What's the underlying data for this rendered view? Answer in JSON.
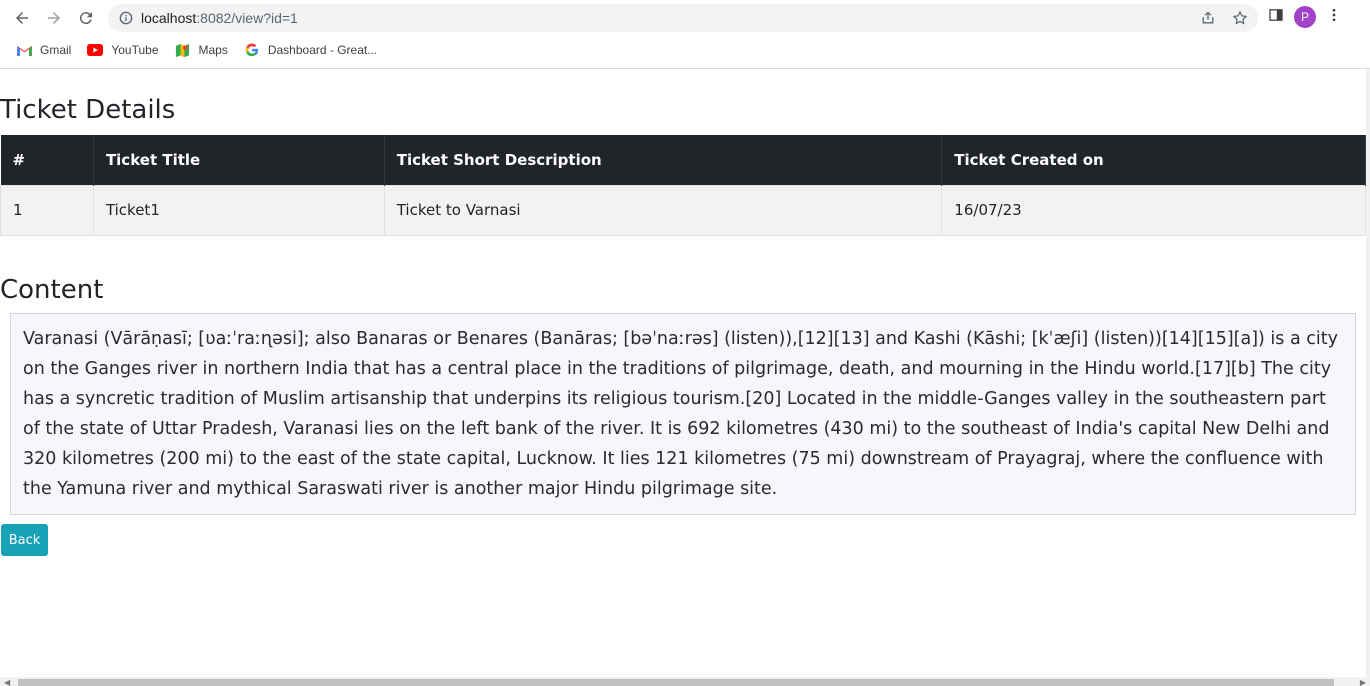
{
  "browser": {
    "url_host": "localhost",
    "url_rest": ":8082/view?id=1",
    "profile_initial": "P",
    "bookmarks": [
      {
        "label": "Gmail",
        "icon": "gmail-icon"
      },
      {
        "label": "YouTube",
        "icon": "youtube-icon"
      },
      {
        "label": "Maps",
        "icon": "maps-icon"
      },
      {
        "label": "Dashboard - Great...",
        "icon": "google-icon"
      }
    ]
  },
  "page": {
    "details_title": "Ticket Details",
    "table": {
      "headers": [
        "#",
        "Ticket Title",
        "Ticket Short Description",
        "Ticket Created on"
      ],
      "rows": [
        [
          "1",
          "Ticket1",
          "Ticket to Varnasi",
          "16/07/23"
        ]
      ]
    },
    "content_title": "Content",
    "content_text": "Varanasi (Vārāṇasī; [ʋaːˈraːɳəsi]; also Banaras or Benares (Banāras; [bəˈnaːrəs] (listen)),[12][13] and Kashi (Kāshi; [kˈæʃi] (listen))[14][15][a]) is a city on the Ganges river in northern India that has a central place in the traditions of pilgrimage, death, and mourning in the Hindu world.[17][b] The city has a syncretic tradition of Muslim artisanship that underpins its religious tourism.[20] Located in the middle-Ganges valley in the southeastern part of the state of Uttar Pradesh, Varanasi lies on the left bank of the river. It is 692 kilometres (430 mi) to the southeast of India's capital New Delhi and 320 kilometres (200 mi) to the east of the state capital, Lucknow. It lies 121 kilometres (75 mi) downstream of Prayagraj, where the confluence with the Yamuna river and mythical Saraswati river is another major Hindu pilgrimage site.",
    "back_label": "Back"
  },
  "colors": {
    "table_header_bg": "#212529",
    "back_button": "#17a2b8",
    "content_bg": "#f6f7fc"
  }
}
